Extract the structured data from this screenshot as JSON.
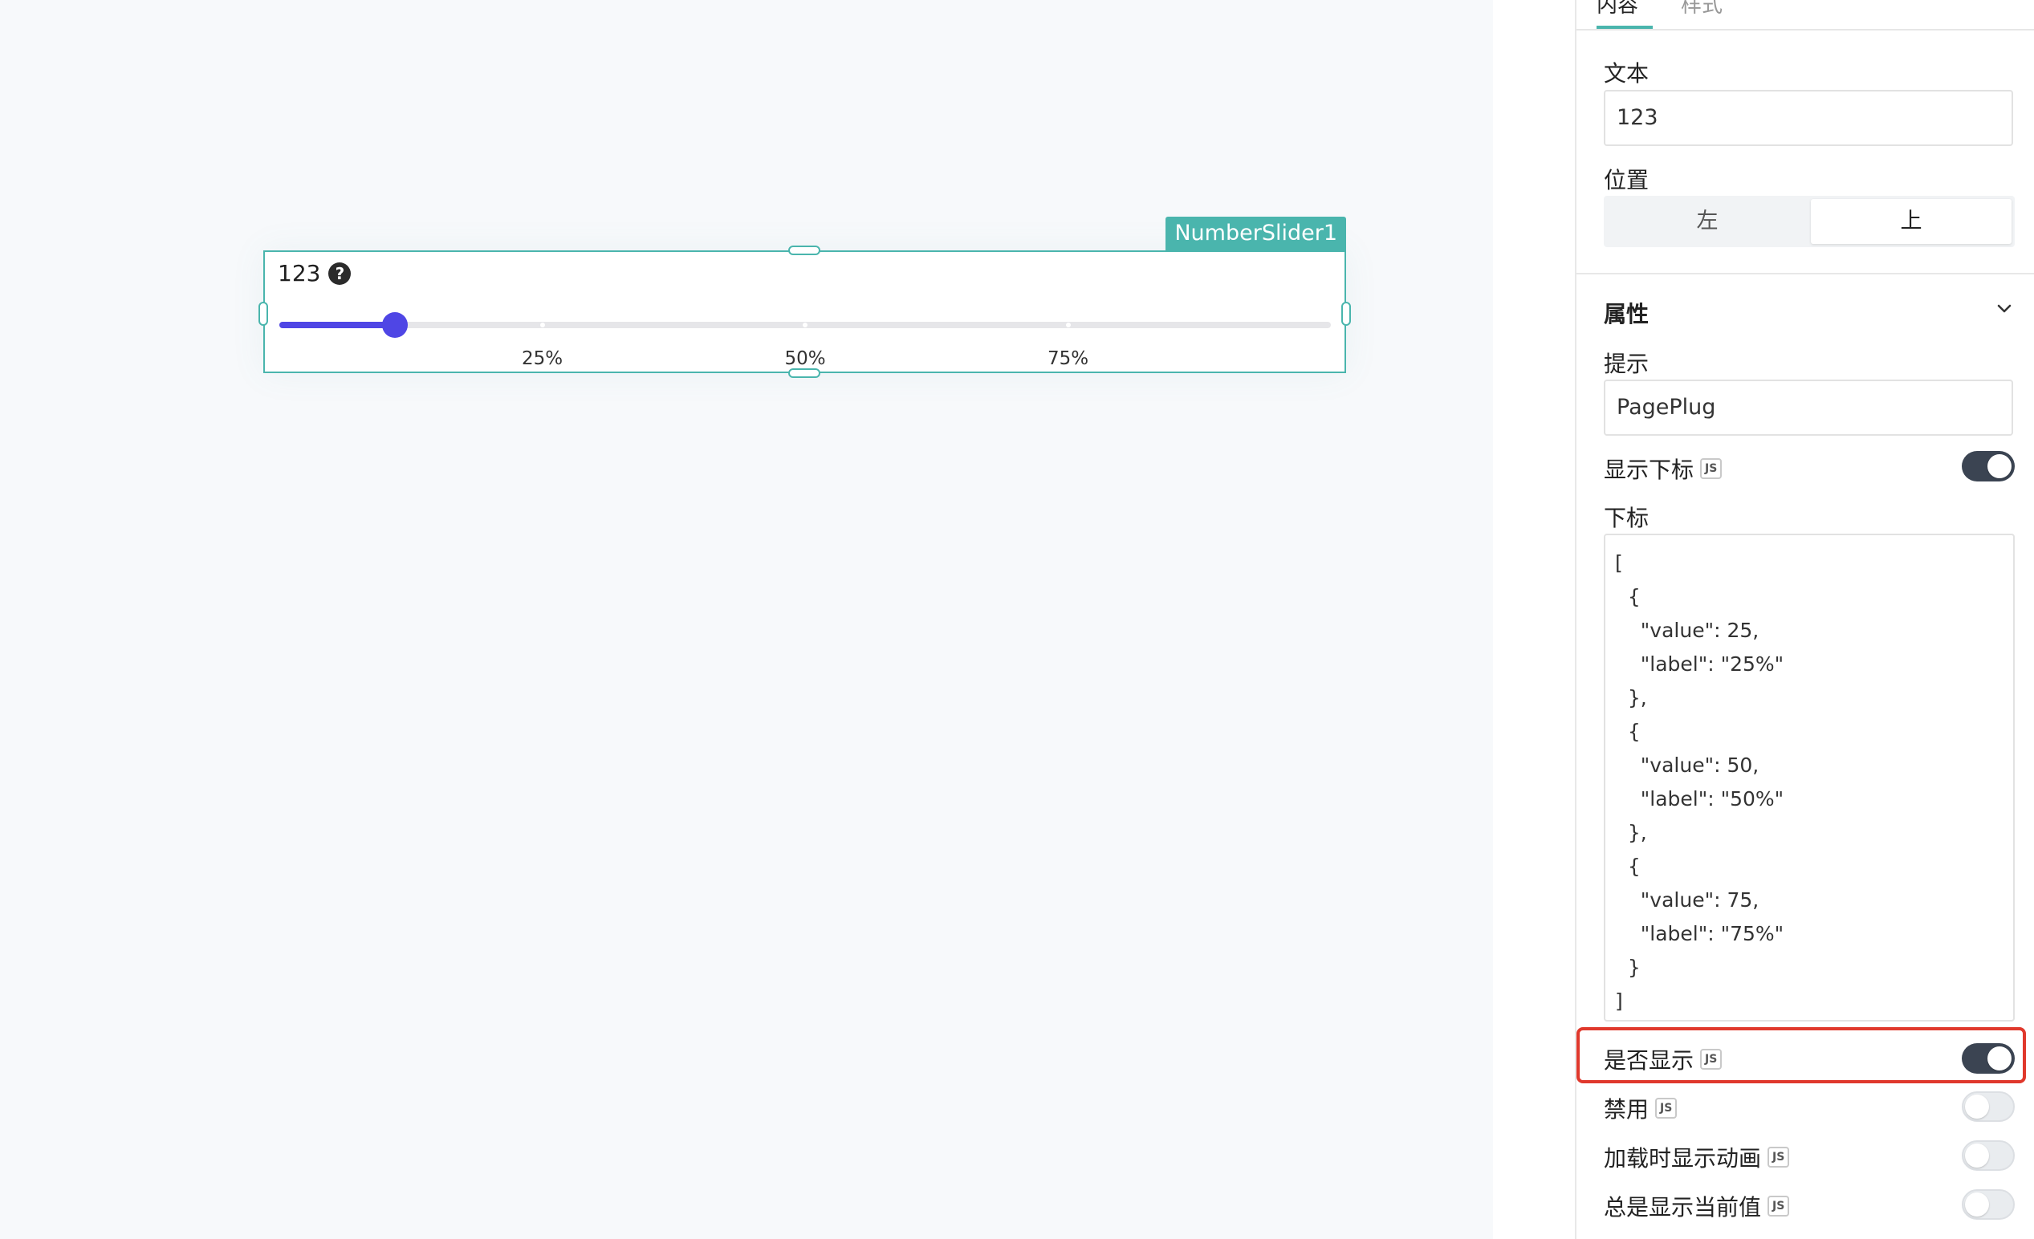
{
  "widget": {
    "name": "NumberSlider1",
    "label": "123",
    "help_icon": "question-circle-icon",
    "value": 11,
    "min": 0,
    "max": 100,
    "marks": [
      {
        "value": 25,
        "label": "25%"
      },
      {
        "value": 50,
        "label": "50%"
      },
      {
        "value": 75,
        "label": "75%"
      }
    ],
    "accent_color": "#4f46e5",
    "border_color": "#4ab5ad"
  },
  "pane": {
    "tabs": [
      "内容",
      "样式"
    ],
    "text_label": "文本",
    "text_value": "123",
    "position_label": "位置",
    "position_options": [
      "左",
      "上"
    ],
    "position_selected": "上",
    "section_title": "属性",
    "tooltip_label": "提示",
    "tooltip_value": "PagePlug",
    "js_badge": "JS",
    "show_marks_label": "显示下标",
    "show_marks_on": true,
    "marks_label": "下标",
    "marks_code": "[\n  {\n    \"value\": 25,\n    \"label\": \"25%\"\n  },\n  {\n    \"value\": 50,\n    \"label\": \"50%\"\n  },\n  {\n    \"value\": 75,\n    \"label\": \"75%\"\n  }\n]",
    "visible_label": "是否显示",
    "visible_on": true,
    "disabled_label": "禁用",
    "disabled_on": false,
    "animate_label": "加载时显示动画",
    "animate_on": false,
    "always_show_label": "总是显示当前值",
    "always_show_on": false,
    "highlight_color": "#e0382c"
  }
}
